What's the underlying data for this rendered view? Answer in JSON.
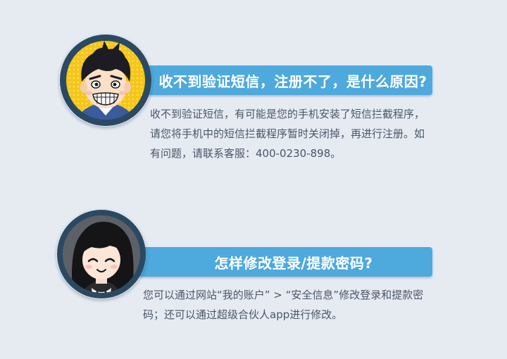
{
  "faq": [
    {
      "question": "收不到验证短信，注册不了，是什么原因?",
      "answer": "收不到验证短信，有可能是您的手机安装了短信拦截程序，请您将手机中的短信拦截程序暂时关闭掉，再进行注册。如有问题，请联系客服：400-0230-898。",
      "avatar": "boy-cartoon-avatar"
    },
    {
      "question": "怎样修改登录/提款密码?",
      "answer": "您可以通过网站“我的账户” > “安全信息”修改登录和提款密码；还可以通过超级合伙人app进行修改。",
      "avatar": "girl-cartoon-avatar"
    }
  ],
  "colors": {
    "background": "#e6ebf2",
    "banner": "#4ea9dc",
    "answer_text": "#4a5565",
    "avatar_ring": "#2b4a62"
  }
}
